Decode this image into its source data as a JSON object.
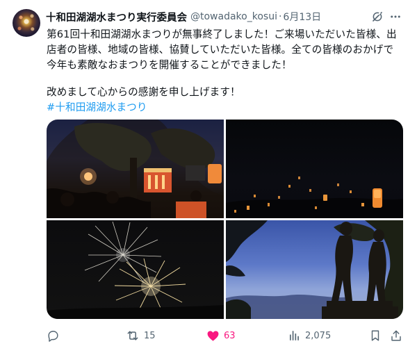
{
  "author": {
    "name": "十和田湖湖水まつり実行委員会",
    "handle": "@towadako_kosui",
    "separator": "·",
    "date": "6月13日"
  },
  "tweet": {
    "lines": [
      "第61回十和田湖湖水まつりが無事終了しました！ご来場いただいた皆様、出",
      "店者の皆様、地域の皆様、協賛していただいた皆様。全ての皆様のおかげで",
      "今年も素敵なおまつりを開催することができました！",
      "改めまして心からの感謝を申し上げます！"
    ],
    "hashtag": "#十和田湖湖水まつり"
  },
  "media": {
    "photos": [
      {
        "label": "湖水まつりの夜の会場"
      },
      {
        "label": "夜空に浮かぶランタン"
      },
      {
        "label": "打ち上げ花火"
      },
      {
        "label": "乙女の像のシルエット"
      }
    ]
  },
  "actions": {
    "reply_icon": "reply-icon",
    "retweet_count": "15",
    "like_count": "63",
    "view_count": "2,075",
    "like_color": "#f91880",
    "icon_color": "#536471",
    "hashtag_color": "#1d9bf0"
  }
}
